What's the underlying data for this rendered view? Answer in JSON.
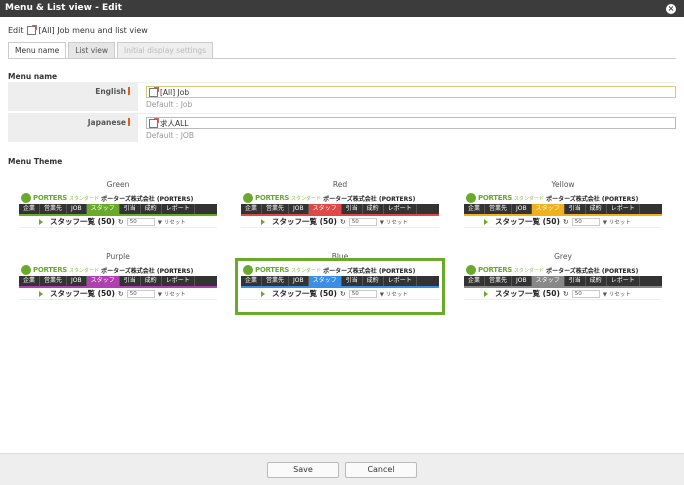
{
  "title": "Menu & List view - Edit",
  "close": "×",
  "edit": {
    "prefix": "Edit",
    "name": "[All] Job menu and list view"
  },
  "tabs": [
    "Menu name",
    "List view",
    "Initial display settings"
  ],
  "menu_name": {
    "section": "Menu name",
    "english": {
      "label": "English",
      "value": "[All] Job",
      "default": "Default : Job"
    },
    "japanese": {
      "label": "Japanese",
      "value": "求人ALL",
      "default": "Default : JOB"
    }
  },
  "menu_theme": {
    "section": "Menu Theme",
    "preview": {
      "brand": "PORTERS",
      "edition": "スタンダード",
      "company": "ポーターズ株式会社 (PORTERS)",
      "menu": [
        "企業",
        "営業先",
        "JOB",
        "スタッフ",
        "引当",
        "成約",
        "レポート"
      ],
      "list_title": "スタッフ一覧 (50)",
      "count": "50",
      "reset": "リセット"
    },
    "themes": [
      {
        "name": "Green",
        "color": "#6aaa2a"
      },
      {
        "name": "Red",
        "color": "#e04848"
      },
      {
        "name": "Yellow",
        "color": "#f0b020"
      },
      {
        "name": "Purple",
        "color": "#b040b0"
      },
      {
        "name": "Blue",
        "color": "#3a8ee6"
      },
      {
        "name": "Grey",
        "color": "#888888"
      }
    ],
    "selected": "Blue"
  },
  "buttons": {
    "save": "Save",
    "cancel": "Cancel"
  }
}
